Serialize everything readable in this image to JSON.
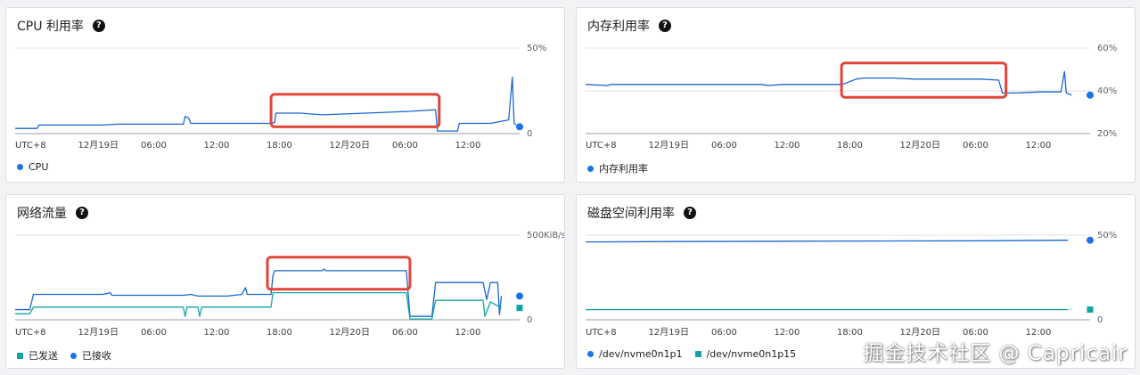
{
  "colors": {
    "blue": "#1a73e8",
    "line_blue": "#1967d2",
    "teal": "#12a4a4",
    "highlight": "#e0453a",
    "grid": "#e0e0e0"
  },
  "icons": {
    "help": "help-circle-icon"
  },
  "panels": [
    {
      "id": "cpu",
      "title": "CPU 利用率",
      "help": "?",
      "ytop_label": "50%",
      "ybot_label": "0",
      "xticks": [
        "UTC+8",
        "12月19日",
        "06:00",
        "12:00",
        "18:00",
        "12月20日",
        "06:00",
        "12:00"
      ],
      "legend": [
        {
          "label": "CPU",
          "marker": "dot",
          "color": "#1a73e8"
        }
      ]
    },
    {
      "id": "memory",
      "title": "内存利用率",
      "help": "?",
      "ytop_label": "60%",
      "ymid_label": "40%",
      "ybot_label": "20%",
      "xticks": [
        "UTC+8",
        "12月19日",
        "06:00",
        "12:00",
        "18:00",
        "12月20日",
        "06:00",
        "12:00"
      ],
      "legend": [
        {
          "label": "内存利用率",
          "marker": "dot",
          "color": "#1a73e8"
        }
      ]
    },
    {
      "id": "network",
      "title": "网络流量",
      "help": "?",
      "ytop_label": "500KiB/s",
      "ybot_label": "0",
      "xticks": [
        "UTC+8",
        "12月19日",
        "06:00",
        "12:00",
        "18:00",
        "12月20日",
        "06:00",
        "12:00"
      ],
      "legend": [
        {
          "label": "已发送",
          "marker": "square",
          "color": "#12a4a4"
        },
        {
          "label": "已接收",
          "marker": "dot",
          "color": "#1a73e8"
        }
      ]
    },
    {
      "id": "disk",
      "title": "磁盘空间利用率",
      "help": "?",
      "ytop_label": "50%",
      "ybot_label": "0",
      "xticks": [
        "UTC+8",
        "12月19日",
        "06:00",
        "12:00",
        "18:00",
        "12月20日",
        "06:00",
        "12:00"
      ],
      "legend": [
        {
          "label": "/dev/nvme0n1p1",
          "marker": "dot",
          "color": "#1a73e8"
        },
        {
          "label": "/dev/nvme0n1p15",
          "marker": "square",
          "color": "#12a4a4"
        }
      ]
    }
  ],
  "chart_data": [
    {
      "type": "line",
      "id": "cpu",
      "title": "CPU 利用率",
      "ylim": [
        0,
        50
      ],
      "x_ticks": [
        "UTC+8",
        "12月19日",
        "06:00",
        "12:00",
        "18:00",
        "12月20日",
        "06:00",
        "12:00"
      ],
      "series": [
        {
          "name": "CPU",
          "points": [
            [
              0,
              3
            ],
            [
              6,
              3
            ],
            [
              6.5,
              5
            ],
            [
              24,
              5
            ],
            [
              28,
              5.5
            ],
            [
              46,
              5.5
            ],
            [
              46.5,
              10
            ],
            [
              47.5,
              9
            ],
            [
              48,
              6
            ],
            [
              62,
              6
            ],
            [
              70,
              6
            ],
            [
              71,
              6.5
            ],
            [
              71.3,
              12
            ],
            [
              72,
              12
            ],
            [
              78,
              12
            ],
            [
              84,
              11
            ],
            [
              96,
              12
            ],
            [
              108,
              13
            ],
            [
              115,
              14
            ],
            [
              115.5,
              1.5
            ],
            [
              121,
              1.5
            ],
            [
              121.5,
              6
            ],
            [
              130,
              6
            ],
            [
              135,
              8
            ],
            [
              136,
              33
            ],
            [
              136.5,
              6
            ],
            [
              137,
              5
            ]
          ],
          "last_value": 4
        }
      ],
      "highlight": {
        "x_range": [
          70,
          116
        ],
        "y_range": [
          4,
          23
        ]
      }
    },
    {
      "type": "line",
      "id": "memory",
      "title": "内存利用率",
      "ylim": [
        20,
        60
      ],
      "x_ticks": [
        "UTC+8",
        "12月19日",
        "06:00",
        "12:00",
        "18:00",
        "12月20日",
        "06:00",
        "12:00"
      ],
      "series": [
        {
          "name": "内存利用率",
          "points": [
            [
              0,
              43
            ],
            [
              6,
              42.5
            ],
            [
              7,
              43
            ],
            [
              24,
              43
            ],
            [
              36,
              43
            ],
            [
              48,
              43
            ],
            [
              50,
              42.5
            ],
            [
              54,
              43
            ],
            [
              60,
              43
            ],
            [
              70,
              43
            ],
            [
              71,
              43.5
            ],
            [
              74,
              45.5
            ],
            [
              76,
              46
            ],
            [
              84,
              46
            ],
            [
              90,
              45.5
            ],
            [
              96,
              45.5
            ],
            [
              108,
              45.5
            ],
            [
              113,
              45
            ],
            [
              114,
              39
            ],
            [
              118,
              39
            ],
            [
              124,
              39.5
            ],
            [
              130,
              39.5
            ],
            [
              131,
              49
            ],
            [
              131.5,
              39
            ],
            [
              133,
              38
            ]
          ],
          "last_value": 38
        }
      ],
      "highlight": {
        "x_range": [
          70,
          115
        ],
        "y_range": [
          37,
          53
        ]
      }
    },
    {
      "type": "line",
      "id": "network",
      "title": "网络流量",
      "unit": "KiB/s",
      "ylim": [
        0,
        500
      ],
      "x_ticks": [
        "UTC+8",
        "12月19日",
        "06:00",
        "12:00",
        "18:00",
        "12月20日",
        "06:00",
        "12:00"
      ],
      "series": [
        {
          "name": "已接收",
          "points": [
            [
              0,
              60
            ],
            [
              4,
              60
            ],
            [
              5,
              150
            ],
            [
              24,
              150
            ],
            [
              26,
              160
            ],
            [
              26.5,
              145
            ],
            [
              46,
              145
            ],
            [
              48,
              150
            ],
            [
              50,
              140
            ],
            [
              58,
              140
            ],
            [
              62,
              150
            ],
            [
              63,
              190
            ],
            [
              63.5,
              150
            ],
            [
              70,
              150
            ],
            [
              70.5,
              260
            ],
            [
              71,
              290
            ],
            [
              80,
              290
            ],
            [
              84,
              290
            ],
            [
              84.5,
              300
            ],
            [
              85,
              290
            ],
            [
              96,
              290
            ],
            [
              107,
              290
            ],
            [
              108,
              20
            ],
            [
              114,
              20
            ],
            [
              115,
              220
            ],
            [
              128,
              220
            ],
            [
              129,
              120
            ],
            [
              130,
              220
            ],
            [
              132,
              220
            ],
            [
              132.5,
              30
            ],
            [
              133,
              140
            ]
          ],
          "last_value": 140
        },
        {
          "name": "已发送",
          "points": [
            [
              0,
              35
            ],
            [
              4,
              35
            ],
            [
              5,
              75
            ],
            [
              46,
              75
            ],
            [
              46.5,
              20
            ],
            [
              47,
              75
            ],
            [
              50,
              75
            ],
            [
              50.5,
              20
            ],
            [
              51,
              75
            ],
            [
              70,
              75
            ],
            [
              70.5,
              160
            ],
            [
              107,
              160
            ],
            [
              108,
              5
            ],
            [
              114,
              5
            ],
            [
              115,
              115
            ],
            [
              128,
              115
            ],
            [
              128.5,
              20
            ],
            [
              130,
              105
            ],
            [
              133,
              70
            ]
          ],
          "last_value": 70
        }
      ],
      "highlight": {
        "x_range": [
          69,
          108
        ],
        "y_range": [
          180,
          370
        ]
      }
    },
    {
      "type": "line",
      "id": "disk",
      "title": "磁盘空间利用率",
      "ylim": [
        0,
        50
      ],
      "x_ticks": [
        "UTC+8",
        "12月19日",
        "06:00",
        "12:00",
        "18:00",
        "12月20日",
        "06:00",
        "12:00"
      ],
      "series": [
        {
          "name": "/dev/nvme0n1p1",
          "points": [
            [
              0,
              46
            ],
            [
              24,
              46.2
            ],
            [
              72,
              46.5
            ],
            [
              110,
              46.7
            ],
            [
              132,
              47
            ]
          ],
          "last_value": 47
        },
        {
          "name": "/dev/nvme0n1p15",
          "points": [
            [
              0,
              6
            ],
            [
              132,
              6
            ]
          ],
          "last_value": 6
        }
      ]
    }
  ],
  "watermark": "掘金技术社区 @ Capricair"
}
